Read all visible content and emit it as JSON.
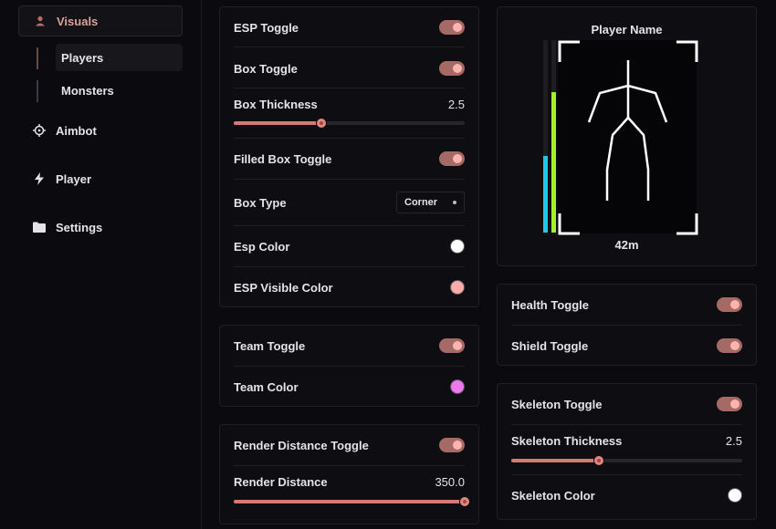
{
  "sidebar": {
    "visuals": "Visuals",
    "players": "Players",
    "monsters": "Monsters",
    "aimbot": "Aimbot",
    "player": "Player",
    "settings": "Settings"
  },
  "esp_card": {
    "esp_toggle": "ESP Toggle",
    "box_toggle": "Box Toggle",
    "box_thickness": "Box Thickness",
    "box_thickness_value": "2.5",
    "box_thickness_fraction": 0.38,
    "filled_box_toggle": "Filled Box Toggle",
    "box_type": "Box Type",
    "box_type_value": "Corner",
    "esp_color": "Esp Color",
    "esp_visible_color": "ESP Visible Color",
    "esp_color_hex": "#ffffff",
    "esp_visible_color_hex": "#ffaaaa"
  },
  "team_card": {
    "team_toggle": "Team Toggle",
    "team_color": "Team Color",
    "team_color_hex": "#ee77ee"
  },
  "render_card": {
    "render_distance_toggle": "Render Distance Toggle",
    "render_distance": "Render Distance",
    "render_distance_value": "350.0",
    "render_distance_fraction": 1.0
  },
  "preview": {
    "player_name": "Player Name",
    "distance": "42m",
    "health_fraction": 0.4,
    "shield_fraction": 0.73,
    "health_color": "#22c6e8",
    "shield_color": "#a6f02a"
  },
  "health_card": {
    "health_toggle": "Health Toggle",
    "shield_toggle": "Shield Toggle"
  },
  "skeleton_card": {
    "skeleton_toggle": "Skeleton Toggle",
    "skeleton_thickness": "Skeleton Thickness",
    "skeleton_thickness_value": "2.5",
    "skeleton_thickness_fraction": 0.38,
    "skeleton_color": "Skeleton Color",
    "skeleton_color_hex": "#ffffff"
  },
  "colors": {
    "accent": "#a56a66",
    "accent_light": "#ffb3ae"
  }
}
